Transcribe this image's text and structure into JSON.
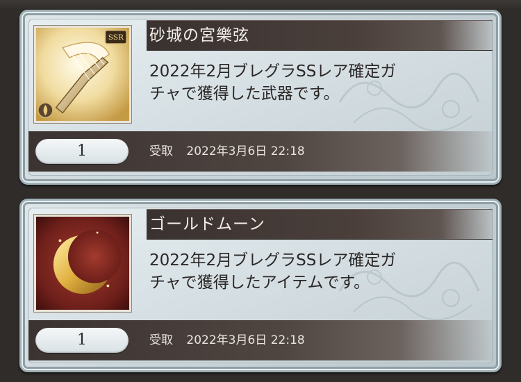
{
  "items": [
    {
      "name": "砂城の宮樂弦",
      "description_line1": "2022年2月ブレグラSSレア確定ガ",
      "description_line2": "チャで獲得した武器です。",
      "quantity": "1",
      "received_label": "受取",
      "received_datetime": "2022年3月6日 22:18",
      "rarity_badge": "SSR",
      "icon": "golden-harp-weapon-icon"
    },
    {
      "name": "ゴールドムーン",
      "description_line1": "2022年2月ブレグラSSレア確定ガ",
      "description_line2": "チャで獲得したアイテムです。",
      "quantity": "1",
      "received_label": "受取",
      "received_datetime": "2022年3月6日 22:18",
      "icon": "gold-moon-item-icon"
    }
  ],
  "colors": {
    "card_bg": "#d3dde1",
    "title_bar": "#3a3230",
    "title_text": "#f2efe8",
    "desc_text": "#2b2727"
  }
}
